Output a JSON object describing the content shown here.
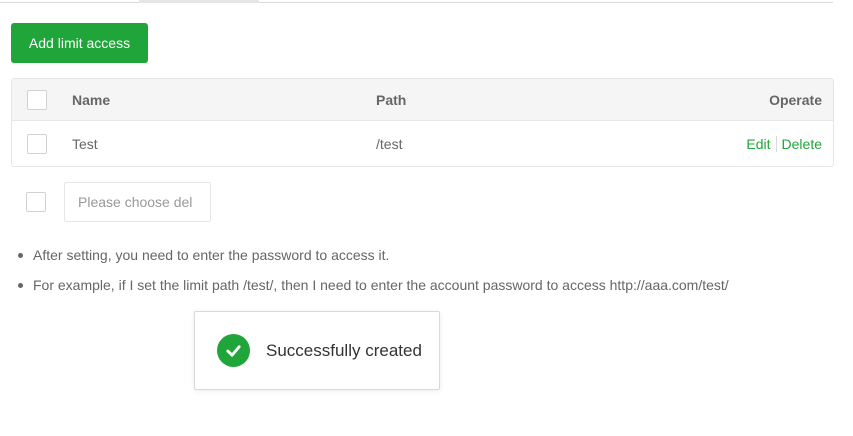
{
  "toolbar": {
    "add_label": "Add limit access"
  },
  "table": {
    "headers": {
      "name": "Name",
      "path": "Path",
      "operate": "Operate"
    },
    "rows": [
      {
        "name": "Test",
        "path": "/test",
        "edit": "Edit",
        "delete": "Delete"
      }
    ]
  },
  "batch": {
    "placeholder": "Please choose del"
  },
  "tips": [
    "After setting, you need to enter the password to access it.",
    "For example, if I set the limit path /test/, then I need to enter the account password to access http://aaa.com/test/"
  ],
  "toast": {
    "message": "Successfully created",
    "icon": "check-circle-icon"
  },
  "colors": {
    "accent": "#20a53a"
  }
}
